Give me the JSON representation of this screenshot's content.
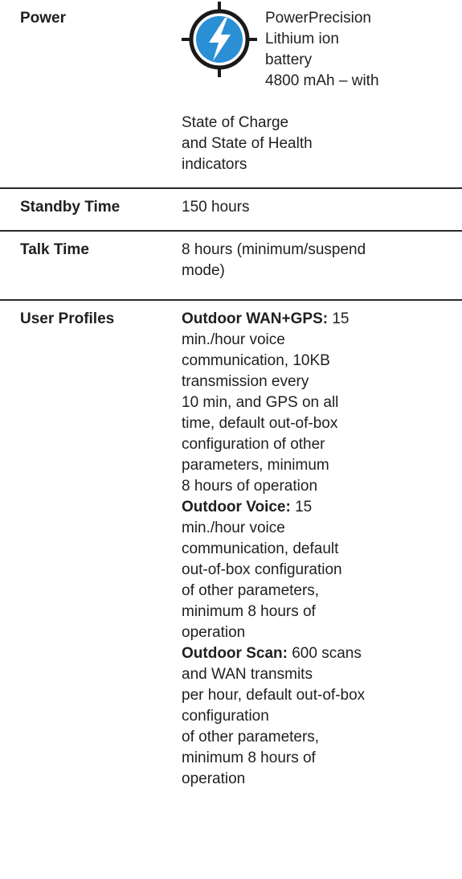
{
  "rows": {
    "power": {
      "label": "Power",
      "icon": "lightning-bolt-crosshair-icon",
      "value_upper": [
        "PowerPrecision",
        "Lithium ion",
        "battery",
        "4800 mAh – with"
      ],
      "value_lower": [
        "State of Charge",
        "and State of Health",
        "indicators"
      ]
    },
    "standby": {
      "label": "Standby Time",
      "value": "150 hours"
    },
    "talk": {
      "label": "Talk Time",
      "value_lines": [
        "8 hours (minimum/suspend",
        "mode)"
      ]
    },
    "profiles": {
      "label": "User Profiles",
      "profiles": [
        {
          "name": "Outdoor WAN+GPS:",
          "first_line_rest": " 15",
          "lines": [
            "min./hour voice",
            "communication, 10KB",
            "transmission every",
            "10 min, and GPS on all",
            "time, default out-of-box",
            "configuration of other",
            "parameters, minimum",
            "8 hours of operation"
          ]
        },
        {
          "name": "Outdoor Voice:",
          "first_line_rest": " 15",
          "lines": [
            "min./hour voice",
            "communication, default",
            "out-of-box configuration",
            "of other parameters,",
            "minimum 8 hours of",
            "operation"
          ]
        },
        {
          "name": "Outdoor Scan:",
          "first_line_rest": " 600 scans",
          "lines": [
            "and WAN transmits",
            "per hour, default out-of-box",
            "configuration",
            "of other parameters,",
            "minimum 8 hours of",
            "operation"
          ]
        }
      ]
    }
  },
  "colors": {
    "text": "#1f1f1f",
    "divider": "#2a2a2a",
    "icon_blue": "#2b8fd6",
    "icon_dark": "#1a1a1a"
  }
}
